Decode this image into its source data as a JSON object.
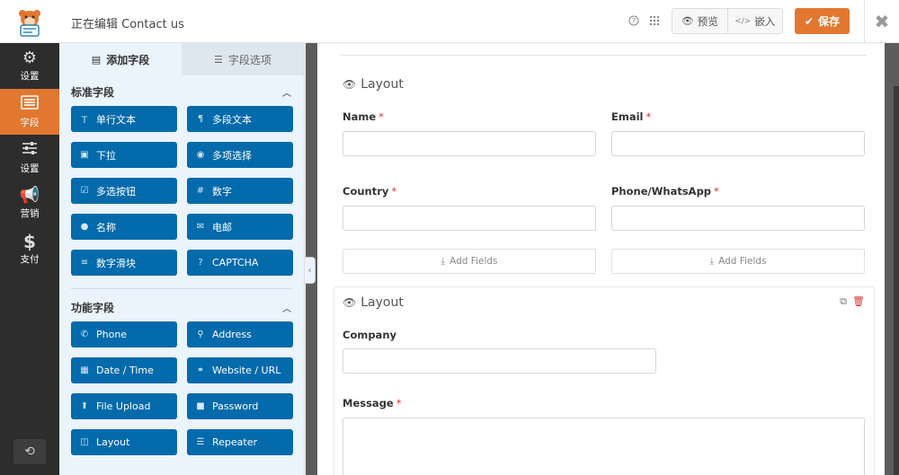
{
  "header": {
    "title": "正在编辑 Contact us",
    "preview_label": "预览",
    "embed_label": "嵌入",
    "save_label": "保存"
  },
  "leftnav": {
    "items": [
      {
        "label": "设置",
        "icon": "gear-icon"
      },
      {
        "label": "字段",
        "icon": "fields-icon"
      },
      {
        "label": "设置",
        "icon": "sliders-icon"
      },
      {
        "label": "营销",
        "icon": "megaphone-icon"
      },
      {
        "label": "支付",
        "icon": "dollar-icon"
      }
    ],
    "active_index": 1
  },
  "panel": {
    "tab_add": "添加字段",
    "tab_options": "字段选项",
    "section_standard": "标准字段",
    "standard_fields": [
      {
        "label": "单行文本",
        "icon": "text-icon"
      },
      {
        "label": "多段文本",
        "icon": "paragraph-icon"
      },
      {
        "label": "下拉",
        "icon": "dropdown-icon"
      },
      {
        "label": "多项选择",
        "icon": "radio-icon"
      },
      {
        "label": "多选按钮",
        "icon": "checkbox-icon"
      },
      {
        "label": "数字",
        "icon": "hash-icon"
      },
      {
        "label": "名称",
        "icon": "user-icon"
      },
      {
        "label": "电邮",
        "icon": "envelope-icon"
      },
      {
        "label": "数字滑块",
        "icon": "slider-icon"
      },
      {
        "label": "CAPTCHA",
        "icon": "question-icon"
      }
    ],
    "section_fancy": "功能字段",
    "fancy_fields": [
      {
        "label": "Phone",
        "icon": "phone-icon"
      },
      {
        "label": "Address",
        "icon": "map-pin-icon"
      },
      {
        "label": "Date / Time",
        "icon": "calendar-icon"
      },
      {
        "label": "Website / URL",
        "icon": "link-icon"
      },
      {
        "label": "File Upload",
        "icon": "upload-icon"
      },
      {
        "label": "Password",
        "icon": "lock-icon"
      },
      {
        "label": "Layout",
        "icon": "layout-icon"
      },
      {
        "label": "Repeater",
        "icon": "repeater-icon"
      }
    ]
  },
  "form": {
    "layout1_title": "Layout",
    "name_label": "Name",
    "email_label": "Email",
    "country_label": "Country",
    "phone_label": "Phone/WhatsApp",
    "required_mark": "*",
    "add_fields_label": "Add Fields",
    "layout2_title": "Layout",
    "company_label": "Company",
    "message_label": "Message"
  },
  "colors": {
    "accent": "#e27730",
    "field_button": "#036aab",
    "nav_bg": "#2d2d2d",
    "required": "#d63638"
  }
}
